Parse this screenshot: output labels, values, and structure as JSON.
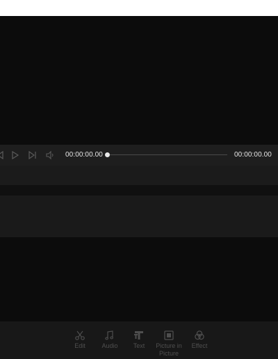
{
  "player": {
    "current_time": "00:00:00.00",
    "total_time": "00:00:00.00",
    "progress": 0
  },
  "toolbar": {
    "items": [
      {
        "label": "Edit",
        "icon": "scissors-icon"
      },
      {
        "label": "Audio",
        "icon": "music-note-icon"
      },
      {
        "label": "Text",
        "icon": "text-icon"
      },
      {
        "label": "Picture in\nPicture",
        "icon": "picture-in-picture-icon"
      },
      {
        "label": "Effect",
        "icon": "effect-icon"
      }
    ]
  },
  "colors": {
    "background": "#0c0c0c",
    "playbar": "#1e1e1e",
    "toolbar": "#181818",
    "disabled": "#4e4e4e"
  }
}
